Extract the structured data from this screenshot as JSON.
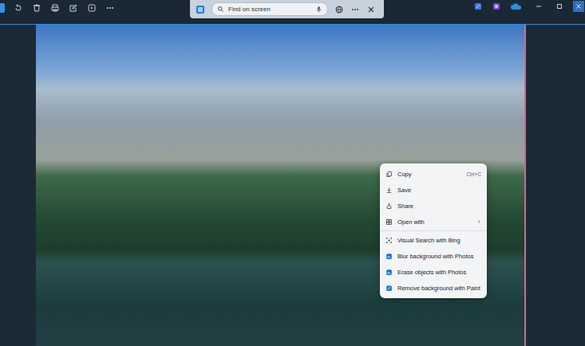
{
  "search": {
    "placeholder": "Find on screen"
  },
  "menu": {
    "groups": [
      [
        {
          "label": "Copy",
          "shortcut": "Ctrl+C",
          "submenu": false
        },
        {
          "label": "Save",
          "shortcut": "",
          "submenu": false
        },
        {
          "label": "Share",
          "shortcut": "",
          "submenu": false
        },
        {
          "label": "Open with",
          "shortcut": "",
          "submenu": true
        }
      ],
      [
        {
          "label": "Visual Search with Bing",
          "shortcut": "",
          "submenu": false
        },
        {
          "label": "Blur background with Photos",
          "shortcut": "",
          "submenu": false
        },
        {
          "label": "Erase objects with Photos",
          "shortcut": "",
          "submenu": false
        },
        {
          "label": "Remove background with Paint",
          "shortcut": "",
          "submenu": false
        }
      ]
    ]
  }
}
